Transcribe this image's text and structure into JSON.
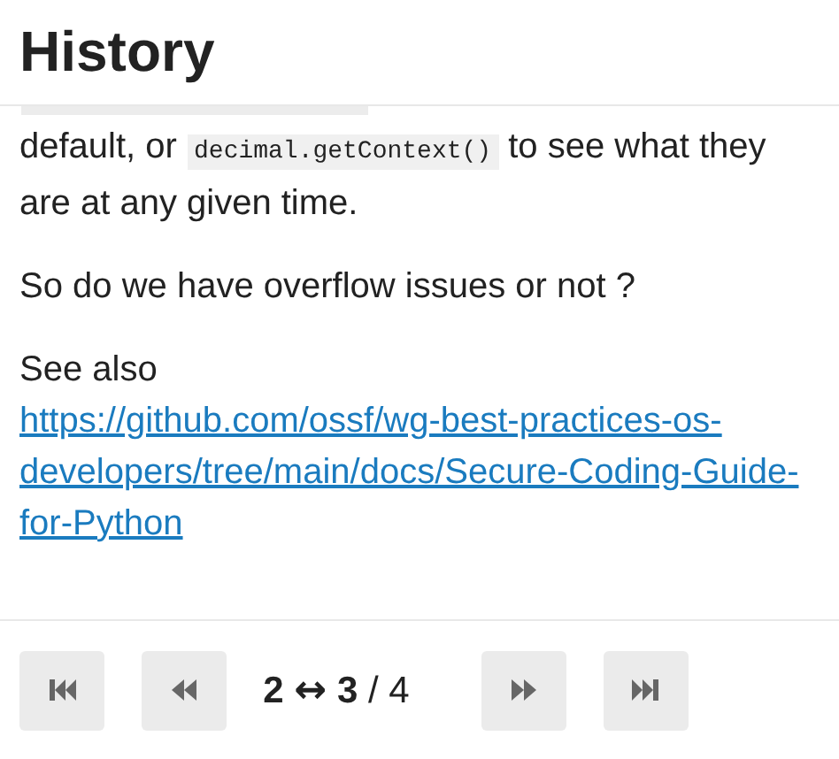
{
  "header": {
    "title": "History"
  },
  "paragraphs": [
    {
      "parts": [
        {
          "kind": "text",
          "text": "default, or "
        },
        {
          "kind": "code",
          "text": "decimal.getContext()"
        },
        {
          "kind": "text",
          "text": " to see what they are at any given time."
        }
      ]
    },
    {
      "parts": [
        {
          "kind": "text",
          "text": "So do we have overflow issues or not ?"
        }
      ]
    },
    {
      "parts": [
        {
          "kind": "text",
          "text": "See also"
        },
        {
          "kind": "break"
        },
        {
          "kind": "link",
          "text": "https://github.com/ossf/wg-best-practices-os-developers/tree/main/docs/Secure-Coding-Guide-for-Python"
        }
      ]
    }
  ],
  "pager": {
    "buttons": [
      {
        "kind": "first"
      },
      {
        "kind": "previous"
      },
      {
        "kind": "next"
      },
      {
        "kind": "last"
      }
    ],
    "counter": {
      "from": "2",
      "arrow": "↔",
      "to": "3",
      "separator": "/",
      "total": "4"
    }
  }
}
